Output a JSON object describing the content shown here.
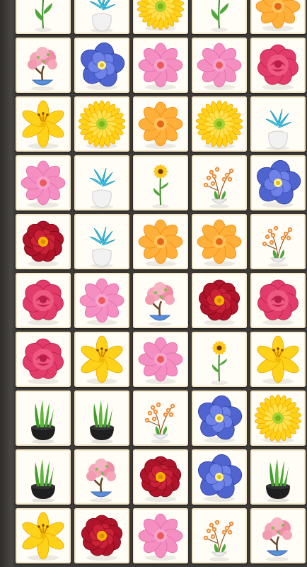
{
  "board": {
    "rows": 10,
    "columns": 5,
    "tiles": [
      [
        "tulip",
        "blue-lily",
        "yellow-gerbera",
        "tulip",
        "orange-daisy"
      ],
      [
        "bonsai",
        "blue-flower",
        "pink-daisy",
        "pink-daisy",
        "pink-rose"
      ],
      [
        "yellow-lily",
        "yellow-gerbera",
        "orange-daisy",
        "yellow-gerbera",
        "blue-lily"
      ],
      [
        "pink-daisy",
        "blue-lily",
        "sunflower",
        "orchid",
        "blue-flower"
      ],
      [
        "red-peony",
        "blue-lily",
        "orange-daisy",
        "orange-daisy",
        "orchid"
      ],
      [
        "pink-rose",
        "pink-daisy",
        "bonsai",
        "red-peony",
        "pink-rose"
      ],
      [
        "pink-rose",
        "yellow-lily",
        "pink-daisy",
        "sunflower",
        "yellow-lily"
      ],
      [
        "grass-pot",
        "grass-pot",
        "orchid",
        "blue-flower",
        "yellow-gerbera"
      ],
      [
        "grass-pot",
        "bonsai",
        "red-peony",
        "blue-flower",
        "grass-pot"
      ],
      [
        "yellow-lily",
        "red-peony",
        "pink-daisy",
        "orchid",
        "bonsai"
      ]
    ]
  }
}
